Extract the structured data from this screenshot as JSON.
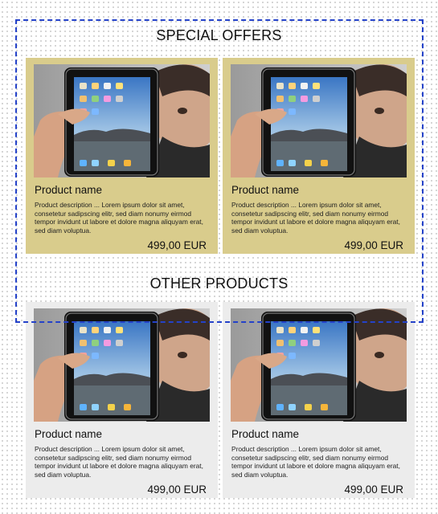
{
  "special": {
    "title": "SPECIAL OFFERS",
    "products": [
      {
        "name": "Product name",
        "description": "Product description  ... Lorem ipsum dolor sit amet, consetetur sadipscing elitr, sed diam nonumy eirmod tempor invidunt ut labore et dolore magna aliquyam erat, sed diam voluptua.",
        "price": "499,00 EUR"
      },
      {
        "name": "Product name",
        "description": "Product description  ... Lorem ipsum dolor sit amet, consetetur sadipscing elitr, sed diam nonumy eirmod tempor invidunt ut labore et dolore magna aliquyam erat, sed diam voluptua.",
        "price": "499,00 EUR"
      }
    ]
  },
  "other": {
    "title": "OTHER PRODUCTS",
    "products": [
      {
        "name": "Product name",
        "description": "Product description  ... Lorem ipsum dolor sit amet, consetetur sadipscing elitr, sed diam nonumy eirmod tempor invidunt ut labore et dolore magna aliquyam erat, sed diam voluptua.",
        "price": "499,00 EUR"
      },
      {
        "name": "Product name",
        "description": "Product description  ... Lorem ipsum dolor sit amet, consetetur sadipscing elitr, sed diam nonumy eirmod tempor invidunt ut labore et dolore magna aliquyam erat, sed diam voluptua.",
        "price": "499,00 EUR"
      }
    ]
  },
  "colors": {
    "special_card_bg": "#d9cc8c",
    "other_card_bg": "#ececec",
    "highlight_frame": "#2442c9"
  },
  "icons": {
    "product_image": "tablet-product-photo"
  }
}
